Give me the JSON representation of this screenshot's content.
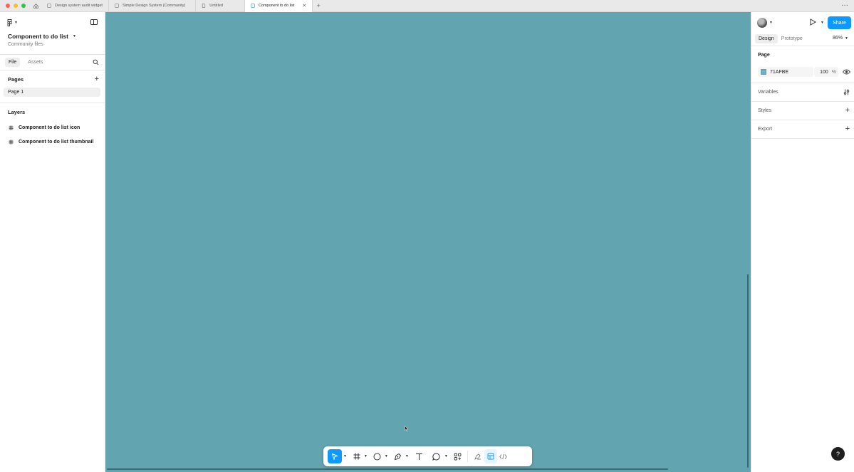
{
  "tabs": [
    {
      "label": "Design system audit widget",
      "active": false
    },
    {
      "label": "Simple Design System (Community)",
      "active": false
    },
    {
      "label": "Untitled",
      "active": false
    },
    {
      "label": "Component to do list",
      "active": true
    }
  ],
  "colors": {
    "canvas": "#63a4b1",
    "accent": "#0d99ff",
    "page_swatch": "#71afbe",
    "traffic_close": "#ff5f57",
    "traffic_min": "#febc2e",
    "traffic_max": "#28c840"
  },
  "left_panel": {
    "file_title": "Component to do list",
    "file_subtitle": "Community files",
    "file_tab": "File",
    "assets_tab": "Assets",
    "pages_heading": "Pages",
    "pages": [
      "Page 1"
    ],
    "layers_heading": "Layers",
    "layers": [
      "Component to do list icon",
      "Component to do list thumbnail"
    ]
  },
  "toolbar": {
    "tools": [
      "move-tool",
      "frame-tool",
      "shape-tool",
      "pen-tool",
      "text-tool",
      "comment-tool",
      "actions-tool",
      "draw-tool",
      "design-mode",
      "dev-mode"
    ]
  },
  "right_panel": {
    "share_label": "Share",
    "design_tab": "Design",
    "prototype_tab": "Prototype",
    "zoom": "86%",
    "page_heading": "Page",
    "page_color_hex": "71AFBE",
    "page_opacity": "100",
    "percent_sign": "%",
    "variables_label": "Variables",
    "styles_label": "Styles",
    "export_label": "Export"
  },
  "help_label": "?"
}
